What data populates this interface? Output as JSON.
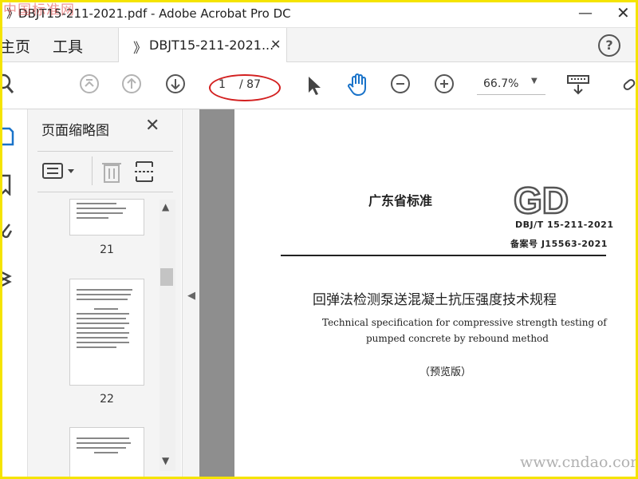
{
  "window": {
    "title": "》DBJT15-211-2021.pdf - Adobe Acrobat Pro DC",
    "minimize": "—",
    "close": "✕"
  },
  "watermarks": {
    "top": "中国标准网",
    "bottom": "www.cndao.com"
  },
  "tabs": {
    "home": "主页",
    "tools": "工具",
    "doc_icon": "》",
    "doc_label": "DBJT15-211-2021...",
    "doc_close": "✕",
    "help": "?"
  },
  "toolbar": {
    "current_page": "1",
    "total_pages": "/ 87",
    "zoom": "66.7%",
    "zoom_caret": "▼"
  },
  "thumbnails": {
    "title": "页面缩略图",
    "close": "✕",
    "pages": [
      "21",
      "22"
    ]
  },
  "document": {
    "standard_label": "广东省标准",
    "logo_text": "GD",
    "code": "DBJ/T 15-211-2021",
    "record": "备案号 J15563-2021",
    "title_cn": "回弹法检测泵送混凝土抗压强度技术规程",
    "title_en_line1": "Technical specification for compressive strength testing of",
    "title_en_line2": "pumped concrete by rebound method",
    "preview": "（预览版）"
  },
  "colors": {
    "accent_hand": "#1a73c9",
    "annotation": "#d32020",
    "frame": "#f5e400"
  }
}
